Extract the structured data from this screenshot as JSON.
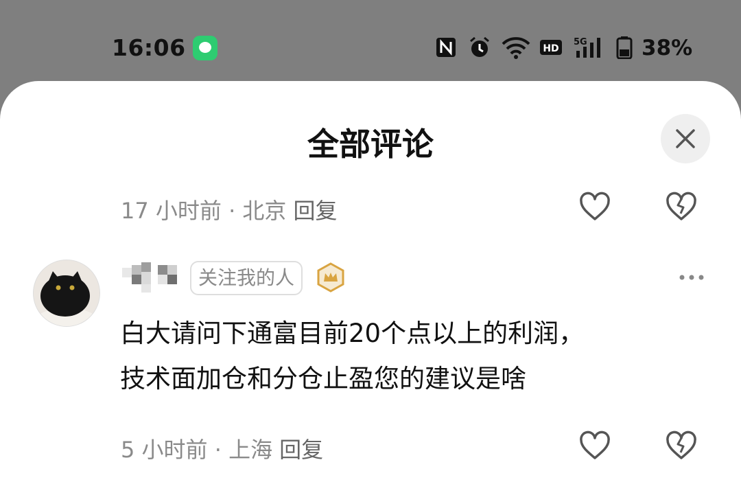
{
  "status_bar": {
    "time": "16:06",
    "icons": [
      "message-app-icon",
      "nfc-icon",
      "alarm-icon",
      "wifi-icon",
      "hd-icon",
      "5g-signal-icon",
      "battery-icon"
    ],
    "battery": "38%"
  },
  "sheet": {
    "title": "全部评论",
    "close_icon": "close-icon"
  },
  "comments": [
    {
      "time": "17 小时前",
      "separator": " · ",
      "location": "北京",
      "reply": "回复"
    },
    {
      "avatar": "black-cat-avatar",
      "tag": "关注我的人",
      "badge": "crown-badge-icon",
      "text_line1": "白大请问下通富目前20个点以上的利润，",
      "text_line2": "技术面加仓和分仓止盈您的建议是啥",
      "time": "5 小时前",
      "separator": " · ",
      "location": "上海",
      "reply": "回复"
    }
  ],
  "colors": {
    "backdrop": "#7f7f7f",
    "sheet": "#ffffff",
    "meta_text": "#8a8a8a",
    "badge_gold": "#d9a441"
  }
}
